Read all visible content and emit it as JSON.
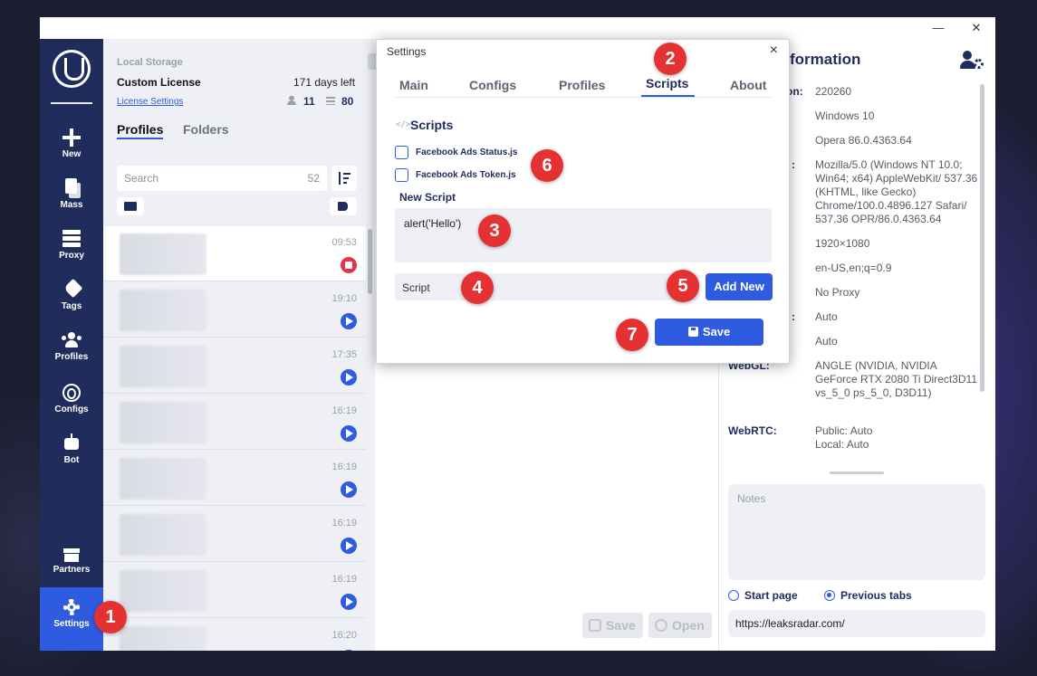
{
  "titlebar": {
    "minimize": "—",
    "close": "✕"
  },
  "sidebar": {
    "items": [
      {
        "label": "New",
        "icon": "plus-icon"
      },
      {
        "label": "Mass",
        "icon": "copy-icon"
      },
      {
        "label": "Proxy",
        "icon": "server-icon"
      },
      {
        "label": "Tags",
        "icon": "tags-icon"
      },
      {
        "label": "Profiles",
        "icon": "users-icon"
      },
      {
        "label": "Configs",
        "icon": "fingerprint-icon"
      },
      {
        "label": "Bot",
        "icon": "robot-icon"
      },
      {
        "label": "Partners",
        "icon": "gift-icon"
      },
      {
        "label": "Settings",
        "icon": "gear-icon"
      }
    ]
  },
  "license": {
    "storage": "Local Storage",
    "name": "Custom License",
    "days_left": "171 days left",
    "settings_link": "License Settings",
    "users_count": "11",
    "profiles_count": "80"
  },
  "list_tabs": {
    "profiles": "Profiles",
    "folders": "Folders"
  },
  "search": {
    "placeholder": "Search",
    "count": "52"
  },
  "profiles": [
    {
      "time": "09:53",
      "status": "running"
    },
    {
      "time": "19:10",
      "status": "stopped"
    },
    {
      "time": "17:35",
      "status": "stopped"
    },
    {
      "time": "16:19",
      "status": "stopped"
    },
    {
      "time": "16:19",
      "status": "stopped"
    },
    {
      "time": "16:19",
      "status": "stopped"
    },
    {
      "time": "16:19",
      "status": "stopped"
    },
    {
      "time": "16:20",
      "status": "stopped"
    }
  ],
  "center": {
    "save": "Save",
    "open": "Open"
  },
  "info": {
    "title": "formation",
    "rows": [
      {
        "key": "on:",
        "value": "220260"
      },
      {
        "key": "",
        "value": "Windows 10"
      },
      {
        "key": "",
        "value": "Opera 86.0.4363.64"
      },
      {
        "key": ":",
        "value": "Mozilla/5.0 (Windows NT 10.0; Win64; x64) AppleWebKit/ 537.36 (KHTML, like Gecko) Chrome/100.0.4896.127 Safari/ 537.36 OPR/86.0.4363.64"
      },
      {
        "key": "",
        "value": "1920×1080"
      },
      {
        "key": "",
        "value": "en-US,en;q=0.9"
      },
      {
        "key": "",
        "value": "No Proxy"
      },
      {
        "key": ":",
        "value": "Auto"
      },
      {
        "key": "",
        "value": "Auto"
      },
      {
        "key": "WebGL:",
        "value": "ANGLE (NVIDIA, NVIDIA GeForce RTX 2080 Ti Direct3D11 vs_5_0 ps_5_0, D3D11)"
      },
      {
        "key": "WebRTC:",
        "value": "Public: Auto\nLocal:  Auto"
      }
    ],
    "notes_placeholder": "Notes",
    "start_page": "Start page",
    "previous_tabs": "Previous tabs",
    "url": "https://leaksradar.com/"
  },
  "modal": {
    "title": "Settings",
    "close": "×",
    "tabs": [
      "Main",
      "Configs",
      "Profiles",
      "Scripts",
      "About"
    ],
    "active_tab": "Scripts",
    "section_icon": "</>",
    "section_title": "Scripts",
    "scripts": [
      "Facebook Ads Status.js",
      "Facebook Ads Token.js"
    ],
    "new_script_label": "New Script",
    "new_script_code": "alert('Hello')",
    "script_name_value": "Script",
    "add_new": "Add New",
    "save": "Save"
  },
  "badges": [
    "1",
    "2",
    "3",
    "4",
    "5",
    "6",
    "7"
  ]
}
